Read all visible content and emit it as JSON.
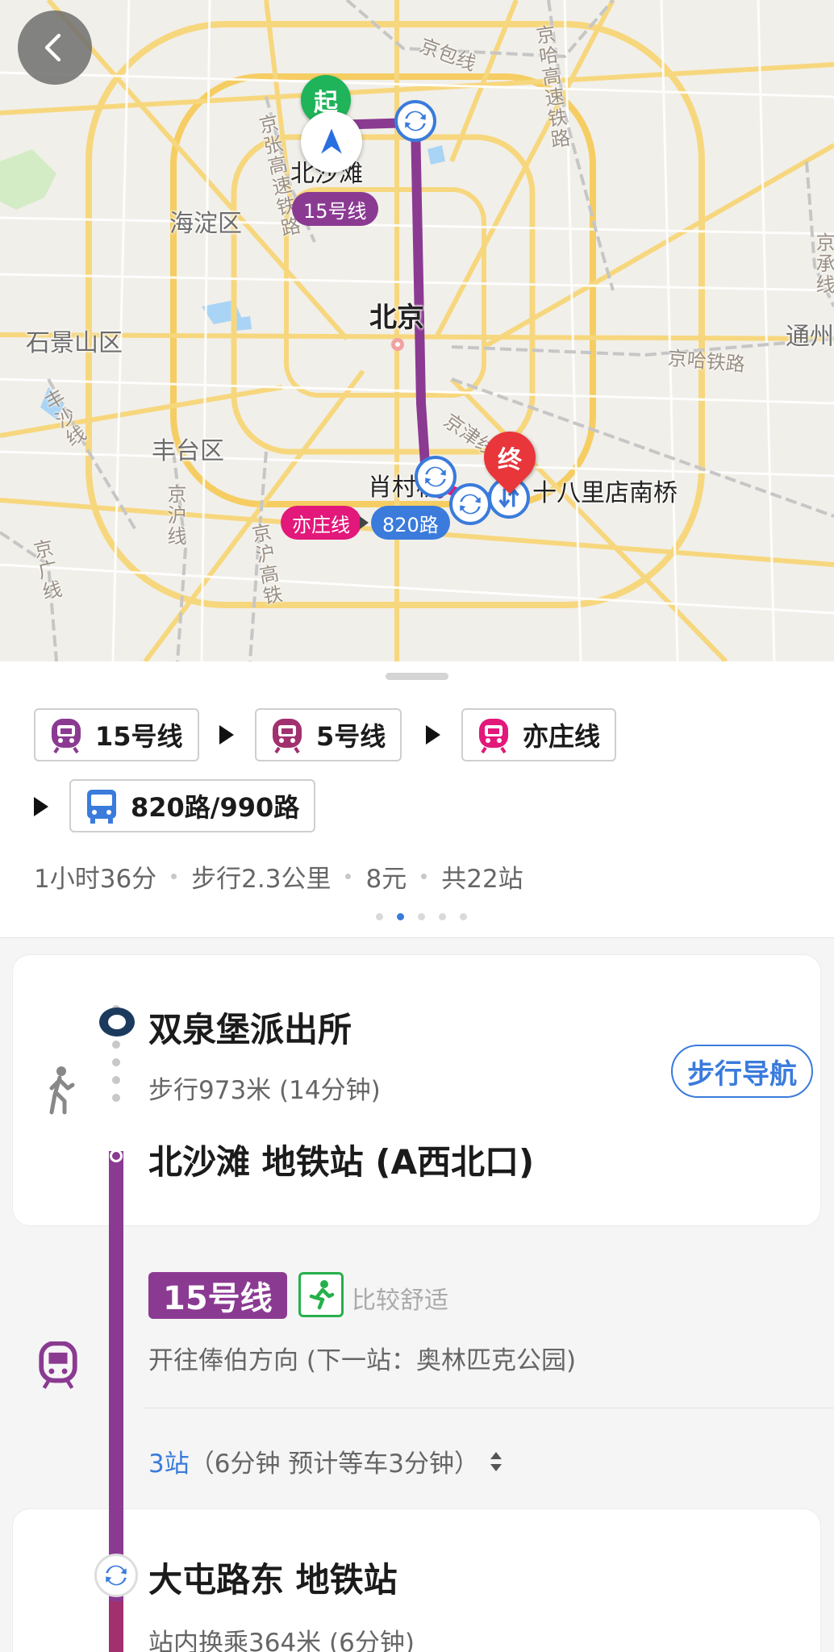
{
  "map": {
    "back_button_icon": "chevron-left-icon",
    "start_pin": "起",
    "end_pin": "终",
    "labels": {
      "haidian": "海淀区",
      "shijingshan": "石景山区",
      "fengtai": "丰台区",
      "beijing": "北京",
      "tongzhou": "通州",
      "beishatan": "北沙滩",
      "xiaocunqiao": "肖村桥",
      "shibalidian": "十八里店南桥"
    },
    "roads": {
      "jingbao": "京包线",
      "jinghagaosu": "京哈高速铁路",
      "jingzhanggaosu": "京张高速铁路",
      "jinghatielu": "京哈铁路",
      "fengshaxian": "丰沙线",
      "jinghuxian": "京沪线",
      "jingguangxian": "京广线",
      "jinghugaotie": "京沪高铁",
      "jingjinxian": "京津线",
      "jingchengxian": "京承线"
    },
    "tags": {
      "line15": "15号线",
      "yizhuang": "亦庄线",
      "bus820": "820路"
    },
    "colors": {
      "line15": "#8b3a92",
      "yizhuang": "#e2187a",
      "bus": "#3a7bdc"
    }
  },
  "summary": {
    "segments": [
      {
        "label": "15号线",
        "icon": "subway-icon",
        "color": "#8b3a92"
      },
      {
        "label": "5号线",
        "icon": "subway-icon",
        "color": "#a1306f"
      },
      {
        "label": "亦庄线",
        "icon": "subway-icon",
        "color": "#e2187a"
      },
      {
        "label": "820路/990路",
        "icon": "bus-icon",
        "color": "#3a7bdc"
      }
    ],
    "duration": "1小时36分",
    "walk": "步行2.3公里",
    "fare": "8元",
    "stations": "共22站",
    "page_index": 1,
    "page_count": 5
  },
  "steps": {
    "origin_title": "双泉堡派出所",
    "walk_detail": "步行973米 (14分钟)",
    "walk_nav_button": "步行导航",
    "station_title": "北沙滩 地铁站 (A西北口)",
    "line_badge": "15号线",
    "comfort_text": "比较舒适",
    "direction": "开往俸伯方向 (下一站：奥林匹克公园)",
    "stop_count": "3站",
    "stop_detail": "（6分钟 预计等车3分钟）",
    "transfer_title": "大屯路东 地铁站",
    "transfer_detail": "站内换乘364米 (6分钟)"
  }
}
